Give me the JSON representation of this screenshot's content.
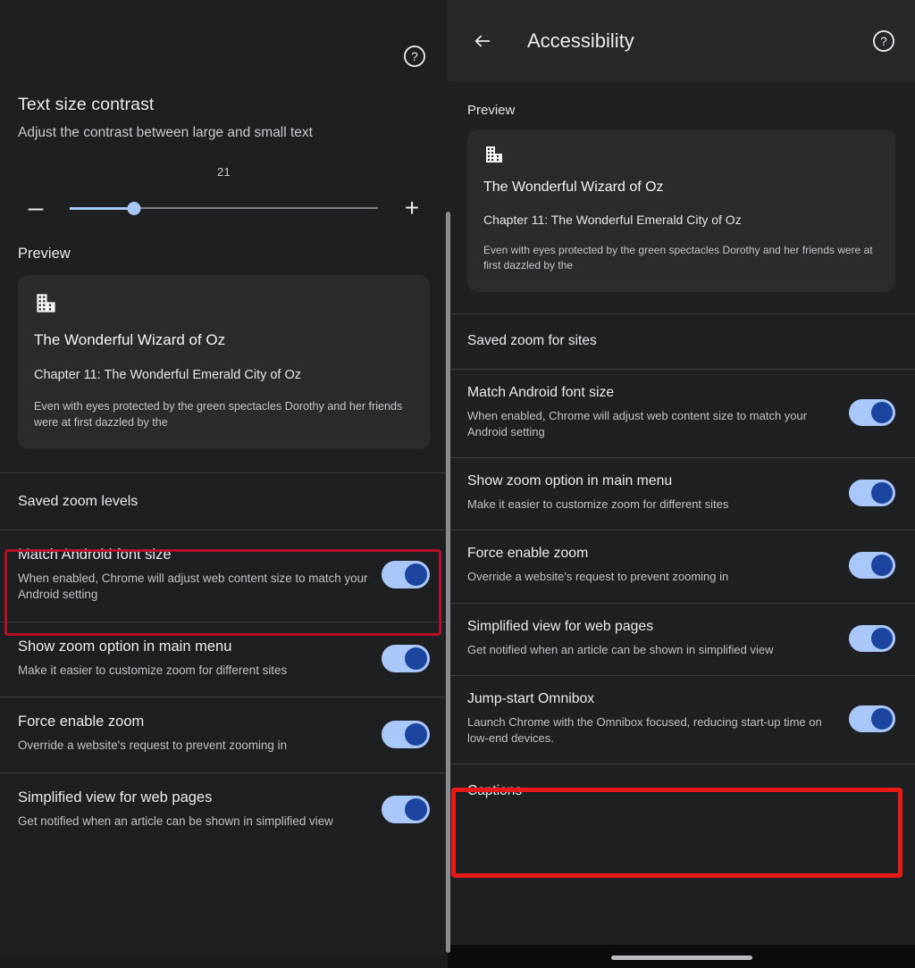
{
  "left_panel": {
    "help_icon": "help-circle-icon",
    "text_size_contrast": {
      "title": "Text size contrast",
      "description": "Adjust the contrast between large and small text",
      "value": "21",
      "minus_label": "–",
      "plus_label": "+",
      "slider_percent": 21
    },
    "preview_label": "Preview",
    "preview_card": {
      "icon": "building-domain-icon",
      "title": "The Wonderful Wizard of Oz",
      "chapter": "Chapter 11: The Wonderful Emerald City of Oz",
      "body": "Even with eyes protected by the green spectacles Dorothy and her friends were at first dazzled by the"
    },
    "category": "Saved zoom levels",
    "settings": [
      {
        "title": "Match Android font size",
        "description": "When enabled, Chrome will adjust web content size to match your Android setting",
        "toggle_on": true,
        "highlighted": true
      },
      {
        "title": "Show zoom option in main menu",
        "description": "Make it easier to customize zoom for different sites",
        "toggle_on": true,
        "highlighted": false
      },
      {
        "title": "Force enable zoom",
        "description": "Override a website's request to prevent zooming in",
        "toggle_on": true,
        "highlighted": false
      },
      {
        "title": "Simplified view for web pages",
        "description": "Get notified when an article can be shown in simplified view",
        "toggle_on": true,
        "highlighted": false
      }
    ]
  },
  "right_panel": {
    "back_icon": "back-arrow-icon",
    "title": "Accessibility",
    "help_icon": "help-circle-icon",
    "preview_label": "Preview",
    "preview_card": {
      "icon": "building-domain-icon",
      "title": "The Wonderful Wizard of Oz",
      "chapter": "Chapter 11: The Wonderful Emerald City of Oz",
      "body": "Even with eyes protected by the green spectacles Dorothy and her friends were at first dazzled by the"
    },
    "category": "Saved zoom for sites",
    "settings": [
      {
        "title": "Match Android font size",
        "description": "When enabled, Chrome will adjust web content size to match your Android setting",
        "toggle_on": true,
        "highlighted": false
      },
      {
        "title": "Show zoom option in main menu",
        "description": "Make it easier to customize zoom for different sites",
        "toggle_on": true,
        "highlighted": false
      },
      {
        "title": "Force enable zoom",
        "description": "Override a website's request to prevent zooming in",
        "toggle_on": true,
        "highlighted": false
      },
      {
        "title": "Simplified view for web pages",
        "description": "Get notified when an article can be shown in simplified view",
        "toggle_on": true,
        "highlighted": false
      },
      {
        "title": "Jump-start Omnibox",
        "description": "Launch Chrome with the Omnibox focused, reducing start-up time on low-end devices.",
        "toggle_on": true,
        "highlighted": true
      }
    ],
    "footer_category": "Captions",
    "gesture_bar": "gesture-navigation-bar"
  },
  "colors": {
    "background": "#1e1f20",
    "card": "#292b2c",
    "toggle_track": "#aac7fa",
    "toggle_knob": "#1b459e",
    "slider_accent": "#a8c7fa",
    "highlight_border": "#e81a17"
  }
}
